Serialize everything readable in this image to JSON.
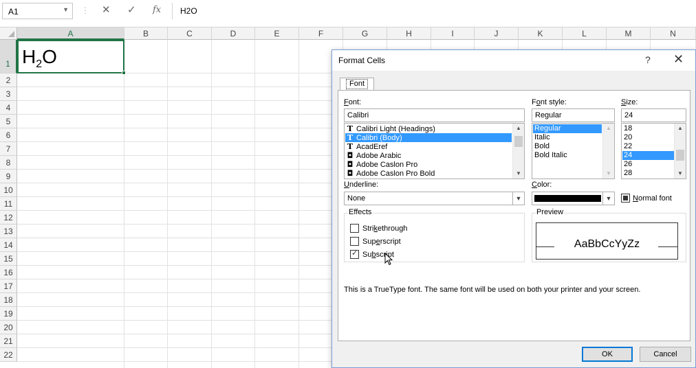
{
  "formula_bar": {
    "name_box": "A1",
    "cancel_icon": "✕",
    "enter_icon": "✓",
    "fx_label": "fx",
    "formula": "H2O"
  },
  "grid": {
    "columns": [
      "A",
      "B",
      "C",
      "D",
      "E",
      "F",
      "G",
      "H",
      "I",
      "J",
      "K",
      "L",
      "M",
      "N"
    ],
    "rows": [
      "1",
      "2",
      "3",
      "4",
      "5",
      "6",
      "7",
      "8",
      "9",
      "10",
      "11",
      "12",
      "13",
      "14",
      "15",
      "16",
      "17",
      "18",
      "19",
      "20",
      "21",
      "22"
    ],
    "active_cell": "A1",
    "cell_a1": {
      "base": "H",
      "subscript": "2",
      "tail": "O"
    }
  },
  "dialog": {
    "title": "Format Cells",
    "help": "?",
    "close": "✕",
    "tab": "Font",
    "font_label": "Font:",
    "font_value": "Calibri",
    "fonts": [
      "Calibri Light (Headings)",
      "Calibri (Body)",
      "AcadEref",
      "Adobe Arabic",
      "Adobe Caslon Pro",
      "Adobe Caslon Pro Bold"
    ],
    "font_selected": "Calibri (Body)",
    "font_style_label": "Font style:",
    "font_style_value": "Regular",
    "font_styles": [
      "Regular",
      "Italic",
      "Bold",
      "Bold Italic"
    ],
    "font_style_selected": "Regular",
    "size_label": "Size:",
    "size_value": "24",
    "sizes": [
      "18",
      "20",
      "22",
      "24",
      "26",
      "28"
    ],
    "size_selected": "24",
    "underline_label": "Underline:",
    "underline_value": "None",
    "color_label": "Color:",
    "color_value": "#000000",
    "normal_font_label": "Normal font",
    "normal_font_checked": true,
    "effects_label": "Effects",
    "strikethrough_label": "Strikethrough",
    "strikethrough_checked": false,
    "superscript_label": "Superscript",
    "superscript_checked": false,
    "subscript_label": "Subscript",
    "subscript_checked": true,
    "preview_label": "Preview",
    "preview_text": "AaBbCcYyZz",
    "description": "This is a TrueType font.  The same font will be used on both your printer and your screen.",
    "ok_label": "OK",
    "cancel_label": "Cancel"
  },
  "colors": {
    "accent": "#217346",
    "selection": "#3399ff",
    "dialog_border": "#7a9cd3"
  }
}
